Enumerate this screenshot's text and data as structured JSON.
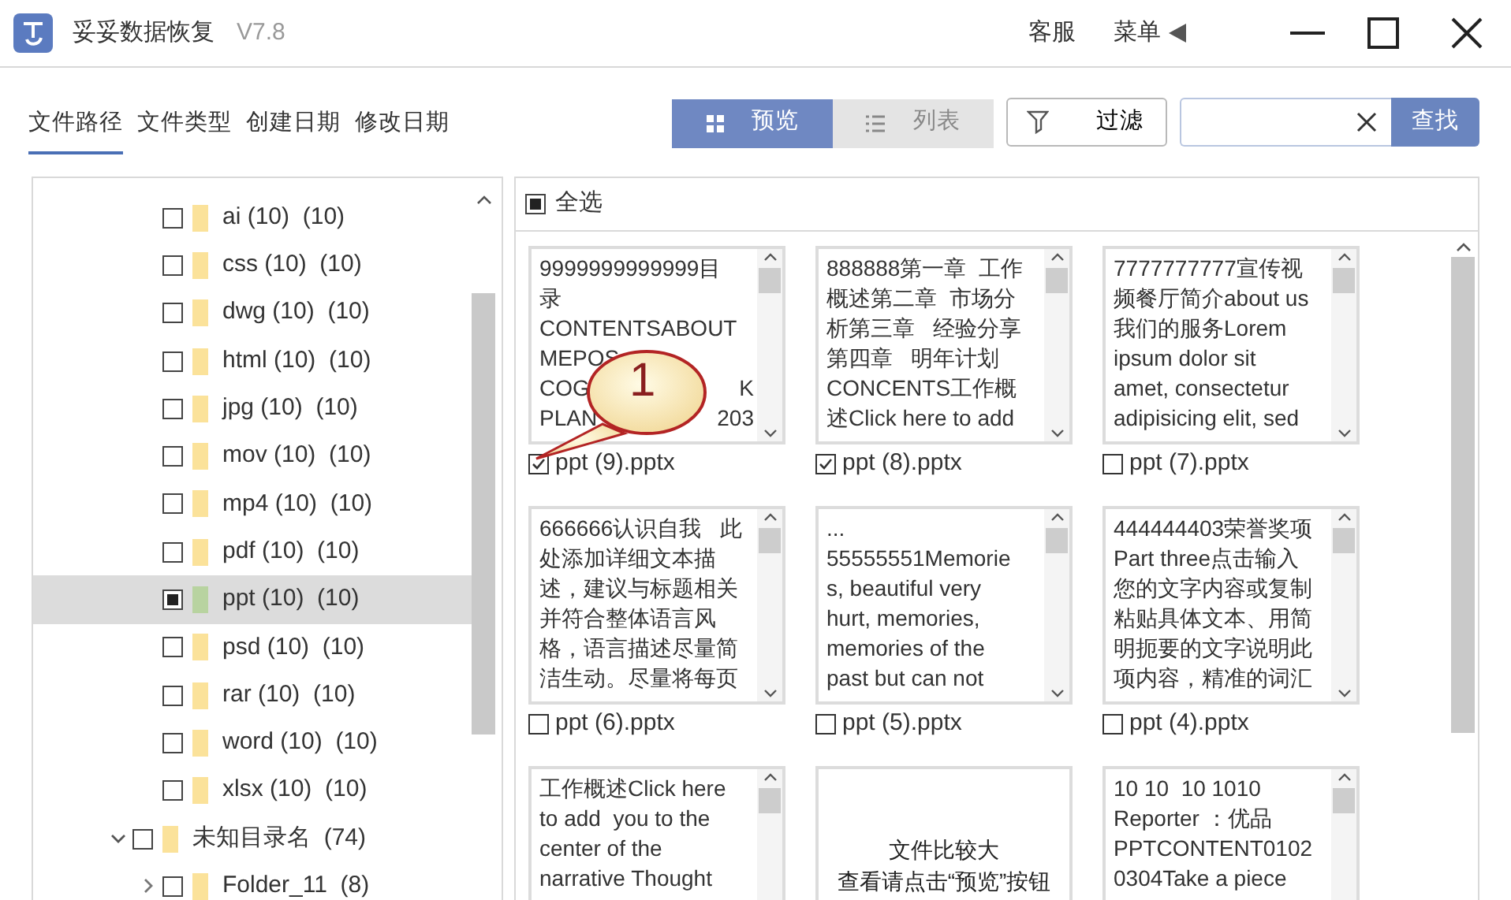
{
  "window": {
    "title": "妥妥数据恢复",
    "version": "V7.8",
    "links": [
      "客服",
      "菜单"
    ]
  },
  "tabs": [
    {
      "label": "文件路径",
      "selected": true
    },
    {
      "label": "文件类型",
      "selected": false
    },
    {
      "label": "创建日期",
      "selected": false
    },
    {
      "label": "修改日期",
      "selected": false
    }
  ],
  "view_toggle": [
    {
      "kind": "grid",
      "label": "预览",
      "selected": true
    },
    {
      "kind": "list",
      "label": "列表",
      "selected": false
    }
  ],
  "filter_button": "过滤",
  "search": {
    "button": "查找"
  },
  "tree": [
    {
      "children": [
        {
          "label": "ai (10)  (10)",
          "checked": false,
          "mixed": false,
          "selected": false
        },
        {
          "label": "css (10)  (10)",
          "checked": false,
          "mixed": false,
          "selected": false
        },
        {
          "label": "dwg (10)  (10)",
          "checked": false,
          "mixed": false,
          "selected": false
        },
        {
          "label": "html (10)  (10)",
          "checked": false,
          "mixed": false,
          "selected": false
        },
        {
          "label": "jpg (10)  (10)",
          "checked": false,
          "mixed": false,
          "selected": false
        },
        {
          "label": "mov (10)  (10)",
          "checked": false,
          "mixed": false,
          "selected": false
        },
        {
          "label": "mp4 (10)  (10)",
          "checked": false,
          "mixed": false,
          "selected": false
        },
        {
          "label": "pdf (10)  (10)",
          "checked": false,
          "mixed": false,
          "selected": false
        },
        {
          "label": "ppt (10)  (10)",
          "checked": false,
          "mixed": true,
          "selected": true
        },
        {
          "label": "psd (10)  (10)",
          "checked": false,
          "mixed": false,
          "selected": false
        },
        {
          "label": "rar (10)  (10)",
          "checked": false,
          "mixed": false,
          "selected": false
        },
        {
          "label": "word (10)  (10)",
          "checked": false,
          "mixed": false,
          "selected": false
        },
        {
          "label": "xlsx (10)  (10)",
          "checked": false,
          "mixed": false,
          "selected": false
        }
      ]
    },
    {
      "label": "未知目录名  (74)",
      "checked": false,
      "mixed": false,
      "selected": false,
      "expanded": true,
      "children": [
        {
          "label": "Folder_11  (8)",
          "checked": false,
          "mixed": false,
          "selected": false,
          "expanded": false
        }
      ]
    }
  ],
  "select_all": {
    "label": "全选",
    "checked": false,
    "mixed": true
  },
  "files": [
    {
      "kind": "preview",
      "lines": [
        [
          "9999999999999目"
        ],
        [
          "录"
        ],
        [
          "CONTENTSABOUT"
        ],
        [
          "MEPOS"
        ],
        [
          "COG",
          "K"
        ],
        [
          "PLAN",
          "203"
        ]
      ],
      "name": "ppt (9).pptx",
      "checked": true
    },
    {
      "kind": "preview",
      "lines": [
        [
          "888888第一章  工作"
        ],
        [
          "概述第二章  市场分"
        ],
        [
          "析第三章   经验分享"
        ],
        [
          "第四章   明年计划"
        ],
        [
          "CONCENTS工作概"
        ],
        [
          "述Click here to add"
        ]
      ],
      "name": "ppt (8).pptx",
      "checked": true
    },
    {
      "kind": "preview",
      "lines": [
        [
          "7777777777宣传视"
        ],
        [
          "频餐厅简介about us"
        ],
        [
          "我们的服务Lorem"
        ],
        [
          "ipsum dolor sit"
        ],
        [
          "amet, consectetur"
        ],
        [
          "adipisicing elit, sed"
        ]
      ],
      "name": "ppt (7).pptx",
      "checked": false
    },
    {
      "kind": "preview",
      "lines": [
        [
          "666666认识自我   此"
        ],
        [
          "处添加详细文本描"
        ],
        [
          "述，建议与标题相关"
        ],
        [
          "并符合整体语言风"
        ],
        [
          "格，语言描述尽量简"
        ],
        [
          "洁生动。尽量将每页"
        ]
      ],
      "name": "ppt (6).pptx",
      "checked": false
    },
    {
      "kind": "preview",
      "lines": [
        [
          "..."
        ],
        [
          "55555551Memorie"
        ],
        [
          "s, beautiful very"
        ],
        [
          "hurt, memories,"
        ],
        [
          "memories of the"
        ],
        [
          "past but can not"
        ]
      ],
      "name": "ppt (5).pptx",
      "checked": false
    },
    {
      "kind": "preview",
      "lines": [
        [
          "444444403荣誉奖项"
        ],
        [
          "Part three点击输入"
        ],
        [
          "您的文字内容或复制"
        ],
        [
          "粘贴具体文本、用简"
        ],
        [
          "明扼要的文字说明此"
        ],
        [
          "项内容，精准的词汇"
        ]
      ],
      "name": "ppt (4).pptx",
      "checked": false
    },
    {
      "kind": "preview",
      "lines": [
        [
          "工作概述Click here"
        ],
        [
          "to add  you to the"
        ],
        [
          "center of the"
        ],
        [
          "narrative Thought"
        ]
      ]
    },
    {
      "kind": "too_large",
      "lines": [
        [
          "文件比较大"
        ],
        [
          "查看请点击“预览”按钮"
        ]
      ]
    },
    {
      "kind": "preview",
      "lines": [
        [
          "10 10  10 1010"
        ],
        [
          "Reporter ：优品"
        ],
        [
          "PPTCONTENT0102"
        ],
        [
          "0304Take a piece"
        ]
      ]
    }
  ],
  "callout": {
    "text": "1"
  }
}
